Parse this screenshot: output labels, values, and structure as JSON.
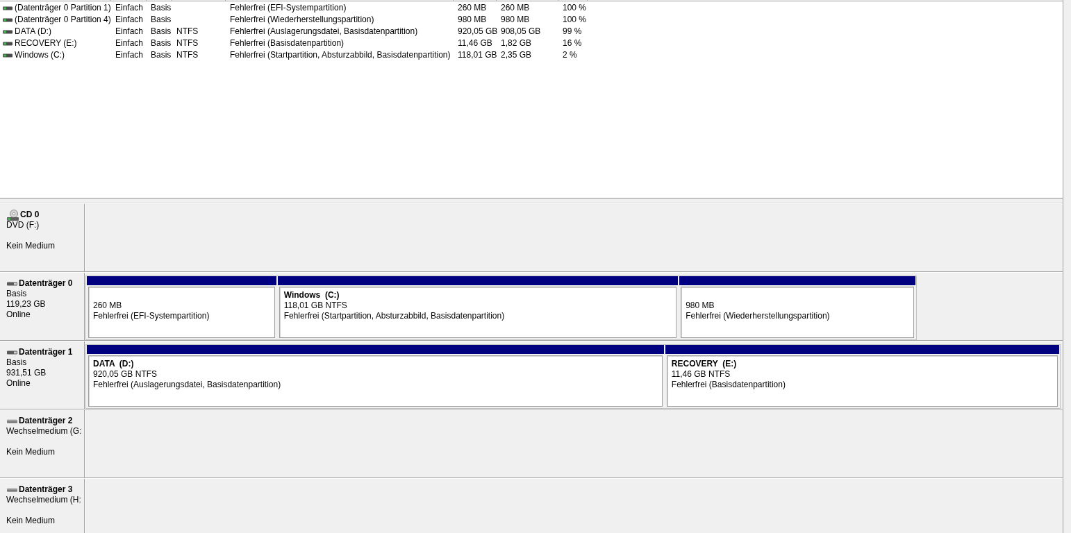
{
  "volume_list": {
    "rows": [
      {
        "column_1": "(Datenträger 0 Partition 1)",
        "column_2": "Einfach",
        "column_3": "Basis",
        "column_5": "Fehlerfrei (EFI-Systempartition)",
        "column_6": "260 MB",
        "column_7": "260 MB",
        "column_8": "100 %"
      },
      {
        "column_1": "(Datenträger 0 Partition 4)",
        "column_2": "Einfach",
        "column_3": "Basis",
        "column_5": "Fehlerfrei (Wiederherstellungspartition)",
        "column_6": "980 MB",
        "column_7": "980 MB",
        "column_8": "100 %"
      },
      {
        "column_1": "DATA (D:)",
        "column_2": "Einfach",
        "column_3": "Basis",
        "column_4": "NTFS",
        "column_5": "Fehlerfrei (Auslagerungsdatei, Basisdatenpartition)",
        "column_6": "920,05 GB",
        "column_7": "908,05 GB",
        "column_8": "99 %"
      },
      {
        "column_1": "RECOVERY (E:)",
        "column_2": "Einfach",
        "column_3": "Basis",
        "column_4": "NTFS",
        "column_5": "Fehlerfrei (Basisdatenpartition)",
        "column_6": "11,46 GB",
        "column_7": "1,82 GB",
        "column_8": "16 %"
      },
      {
        "column_1": "Windows (C:)",
        "column_2": "Einfach",
        "column_3": "Basis",
        "column_4": "NTFS",
        "column_5": "Fehlerfrei (Startpartition, Absturzabbild, Basisdatenpartition)",
        "column_6": "118,01 GB",
        "column_7": "2,35 GB",
        "column_8": "2 %"
      }
    ]
  },
  "disk_view": {
    "disks": [
      {
        "kind": "cdrom",
        "name": "CD 0",
        "type": "DVD (F:)",
        "status": "Kein Medium"
      },
      {
        "kind": "basic",
        "name": "Datenträger 0",
        "type": "Basis",
        "size": "119,23 GB",
        "status": "Online",
        "partitions": [
          {
            "size": "260 MB",
            "status": "Fehlerfrei (EFI-Systempartition)"
          },
          {
            "name": "Windows  (C:)",
            "size": "118,01 GB NTFS",
            "status": "Fehlerfrei (Startpartition, Absturzabbild, Basisdatenpartition)"
          },
          {
            "size": "980 MB",
            "status": "Fehlerfrei (Wiederherstellungspartition)"
          }
        ]
      },
      {
        "kind": "basic",
        "name": "Datenträger 1",
        "type": "Basis",
        "size": "931,51 GB",
        "status": "Online",
        "partitions": [
          {
            "name": "DATA  (D:)",
            "size": "920,05 GB NTFS",
            "status": "Fehlerfrei (Auslagerungsdatei, Basisdatenpartition)"
          },
          {
            "name": "RECOVERY  (E:)",
            "size": "11,46 GB NTFS",
            "status": "Fehlerfrei (Basisdatenpartition)"
          }
        ]
      },
      {
        "kind": "removable",
        "name": "Datenträger 2",
        "type": "Wechselmedium (G:",
        "status": "Kein Medium"
      },
      {
        "kind": "removable",
        "name": "Datenträger 3",
        "type": "Wechselmedium (H:",
        "status": "Kein Medium"
      }
    ]
  }
}
